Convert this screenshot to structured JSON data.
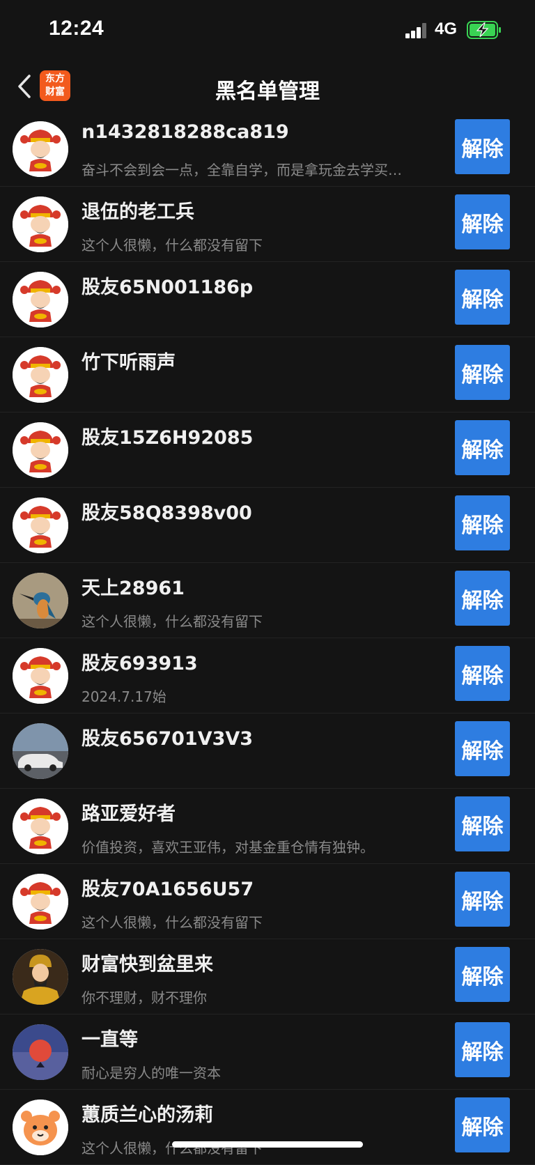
{
  "status": {
    "time": "12:24",
    "network": "4G"
  },
  "header": {
    "title": "黑名单管理",
    "logo_line1": "东方",
    "logo_line2": "财富"
  },
  "users": [
    {
      "name": "n1432818288ca819",
      "bio": "奋斗不会到会一点，全靠自学，而是拿玩金去学买…",
      "avatar": "caishen-icon",
      "action": "解除"
    },
    {
      "name": "退伍的老工兵",
      "bio": "这个人很懒，什么都没有留下",
      "avatar": "caishen-icon",
      "action": "解除"
    },
    {
      "name": "股友65N001186p",
      "bio": "",
      "avatar": "caishen-icon",
      "action": "解除"
    },
    {
      "name": "竹下听雨声",
      "bio": "",
      "avatar": "caishen-icon",
      "action": "解除"
    },
    {
      "name": "股友15Z6H92085",
      "bio": "",
      "avatar": "caishen-icon",
      "action": "解除"
    },
    {
      "name": "股友58Q8398v00",
      "bio": "",
      "avatar": "caishen-icon",
      "action": "解除"
    },
    {
      "name": "天上28961",
      "bio": "这个人很懒，什么都没有留下",
      "avatar": "kingfisher-photo",
      "action": "解除"
    },
    {
      "name": "股友693913",
      "bio": "2024.7.17始",
      "avatar": "caishen-icon",
      "action": "解除"
    },
    {
      "name": "股友656701V3V3",
      "bio": "",
      "avatar": "car-photo",
      "action": "解除"
    },
    {
      "name": "路亚爱好者",
      "bio": "价值投资，喜欢王亚伟，对基金重仓情有独钟。",
      "avatar": "caishen-icon",
      "action": "解除"
    },
    {
      "name": "股友70A1656U57",
      "bio": "这个人很懒，什么都没有留下",
      "avatar": "caishen-icon",
      "action": "解除"
    },
    {
      "name": "财富快到盆里来",
      "bio": "你不理财，财不理你",
      "avatar": "god-of-wealth-photo",
      "action": "解除"
    },
    {
      "name": "一直等",
      "bio": "耐心是穷人的唯一资本",
      "avatar": "sunset-photo",
      "action": "解除"
    },
    {
      "name": "蕙质兰心的汤莉",
      "bio": "这个人很懒，什么都没有留下",
      "avatar": "tiger-icon",
      "action": "解除"
    }
  ]
}
